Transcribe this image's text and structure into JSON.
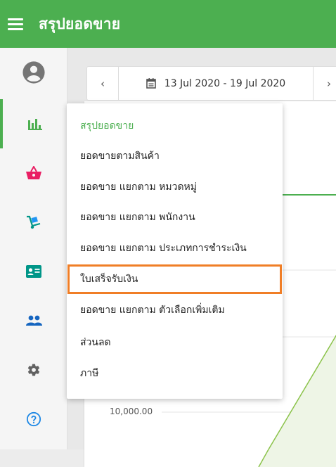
{
  "app": {
    "title": "สรุปยอดขาย"
  },
  "date_nav": {
    "prev": "‹",
    "next": "›",
    "range": "13 Jul 2020 - 19 Jul 2020"
  },
  "chart": {
    "y_tick": "10,000.00"
  },
  "menu": {
    "items": [
      {
        "label": "สรุปยอดขาย"
      },
      {
        "label": "ยอดขายตามสินค้า"
      },
      {
        "label": "ยอดขาย แยกตาม หมวดหมู่"
      },
      {
        "label": "ยอดขาย แยกตาม พนักงาน"
      },
      {
        "label": "ยอดขาย แยกตาม ประเภทการชำระเงิน"
      },
      {
        "label": "ใบเสร็จรับเงิน"
      },
      {
        "label": "ยอดขาย แยกตาม ตัวเลือกเพิ่มเติม"
      },
      {
        "label": "ส่วนลด"
      },
      {
        "label": "ภาษี"
      }
    ]
  },
  "colors": {
    "accent": "#4caf50",
    "highlight": "#f07e26",
    "pink": "#e91e63",
    "teal": "#009688",
    "blue": "#2196f3"
  }
}
